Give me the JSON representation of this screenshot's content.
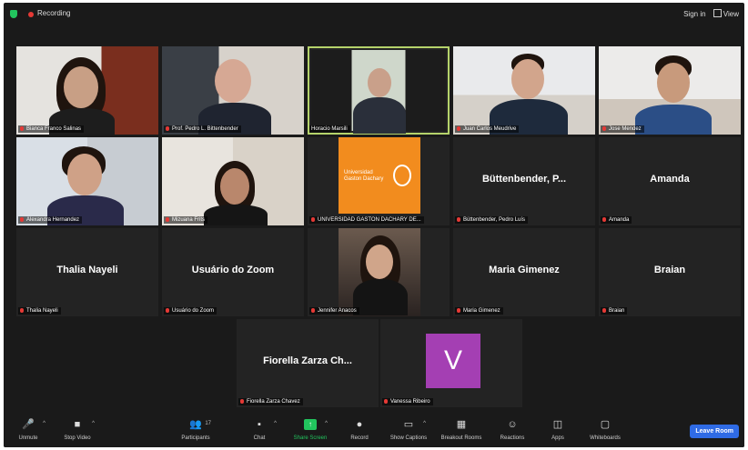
{
  "topbar": {
    "recording_label": "Recording",
    "sign_in_label": "Sign in",
    "view_label": "View"
  },
  "participants": [
    {
      "label": "Bianca Franco Salinas"
    },
    {
      "label": "Prof. Pedro L. Bittenbender"
    },
    {
      "label": "Horacio Marsili"
    },
    {
      "label": "Juan Carlos Meudrive"
    },
    {
      "label": "Jose Mendez"
    },
    {
      "label": "Alexandra Hernandez"
    },
    {
      "label": "Mizuana Frits"
    },
    {
      "label": "UNIVERSIDAD GASTON DACHARY DE..."
    },
    {
      "name": "Büttenbender, P...",
      "label": "Büttenbender, Pedro Luís"
    },
    {
      "name": "Amanda",
      "label": "Amanda"
    },
    {
      "name": "Thalia Nayeli",
      "label": "Thalia Nayeli"
    },
    {
      "name": "Usuário do Zoom",
      "label": "Usuário do Zoom"
    },
    {
      "label": "Jennifer Anacos"
    },
    {
      "name": "Maria Gimenez",
      "label": "Maria Gimenez"
    },
    {
      "name": "Braian",
      "label": "Braian"
    },
    {
      "name": "Fiorella Zarza Ch...",
      "label": "Fiorella Zarza Chavez"
    },
    {
      "avatar": "V",
      "label": "Vanessa Ribeiro"
    }
  ],
  "logo_text": "Universidad Gaston Dachary",
  "toolbar": {
    "unmute": "Unmute",
    "stop_video": "Stop Video",
    "participants": "Participants",
    "participants_count": "17",
    "chat": "Chat",
    "share_screen": "Share Screen",
    "record": "Record",
    "show_captions": "Show Captions",
    "breakout_rooms": "Breakout Rooms",
    "reactions": "Reactions",
    "apps": "Apps",
    "whiteboards": "Whiteboards",
    "leave": "Leave Room"
  },
  "colors": {
    "accent": "#b5d36b",
    "share": "#22c55e",
    "leave": "#2f6be5",
    "avatar": "#a43fb3",
    "logo": "#f28c1e"
  }
}
